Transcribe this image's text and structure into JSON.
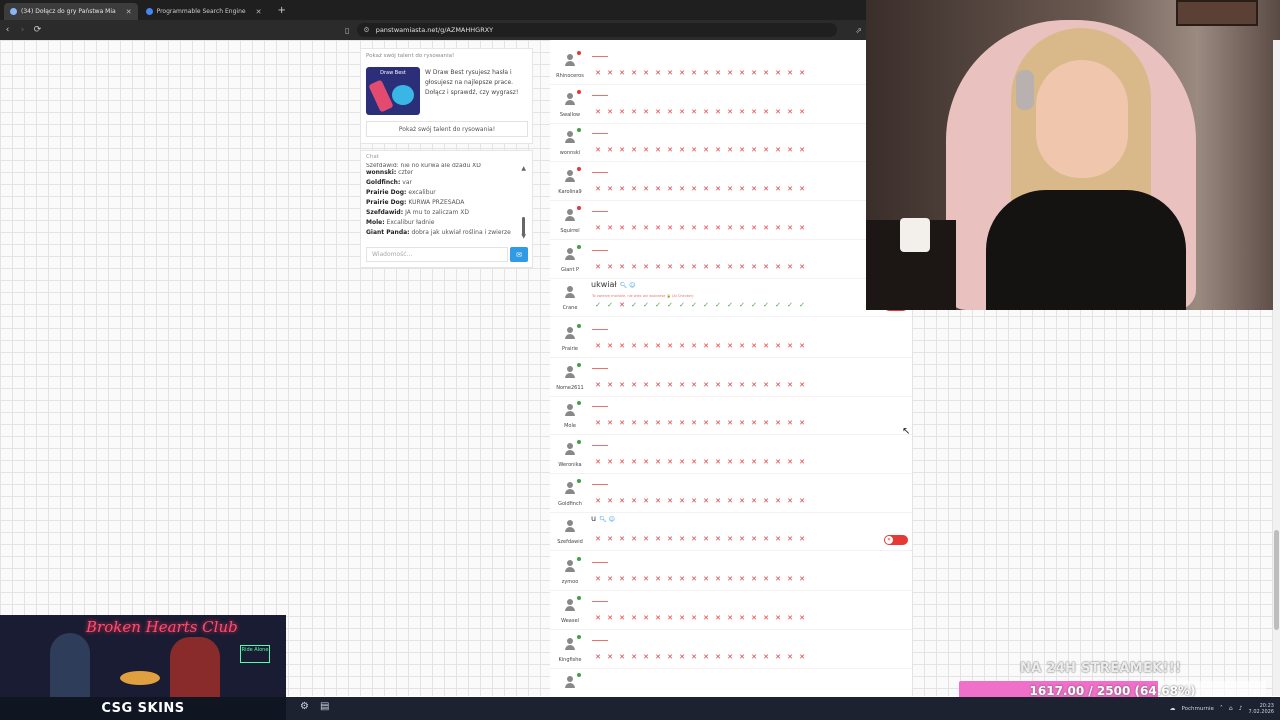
{
  "browser": {
    "tabs": [
      {
        "label": "(34) Dołącz do gry Państwa Mia",
        "active": true
      },
      {
        "label": "Programmable Search Engine",
        "active": false
      }
    ],
    "url": "panstwamiasta.net/g/AZMAHHGRXY"
  },
  "ad": {
    "heading": "Pokaż swój talent do rysowania!",
    "image_title": "Draw Best",
    "text": "W Draw Best rysujesz hasła i głosujesz na najlepsze prace. Dołącz i sprawdź, czy wygrasz!",
    "button": "Pokaż swój talent do rysowania!"
  },
  "chat": {
    "heading": "Chat",
    "partial_line": "Szefdawid: nie no kurwa ale dzadu XD",
    "messages": [
      {
        "user": "wonnski:",
        "text": "czter"
      },
      {
        "user": "Goldfinch:",
        "text": "var"
      },
      {
        "user": "Prairie Dog:",
        "text": "excalibur"
      },
      {
        "user": "Prairie Dog:",
        "text": "KURWA PRZESADA"
      },
      {
        "user": "Szefdawid:",
        "text": "JA mu to zaliczam XD"
      },
      {
        "user": "Mole:",
        "text": "Excalibur ładnie"
      },
      {
        "user": "Giant Panda:",
        "text": "dobra jak ukwiał roślina i zwierze"
      }
    ],
    "placeholder": "Wiadomość..."
  },
  "players": [
    {
      "name": "Rhinoceros",
      "status": "red",
      "answer": "",
      "marks": "xxxxxxxxxxxxxxxxxx"
    },
    {
      "name": "Swallow",
      "status": "red",
      "answer": "",
      "marks": "xxxxxxxxxxxxxxxxxx"
    },
    {
      "name": "wonnski",
      "status": "green",
      "answer": "",
      "marks": "xxxxxxxxxxxxxxxxxx"
    },
    {
      "name": "Karolina9",
      "status": "red",
      "answer": "",
      "marks": "xxxxxxxxxxxxxxxxxx"
    },
    {
      "name": "Squirrel",
      "status": "red",
      "answer": "",
      "marks": "xxxxxxxxxxxxxxxxxx"
    },
    {
      "name": "Giant P",
      "status": "green",
      "answer": "",
      "marks": "xxxxxxxxxxxxxxxxxx"
    },
    {
      "name": "Crane",
      "status": "none",
      "answer": "ukwiał",
      "hint": "To zwierzę morskie, nie więc ani wskrzesę 🔒 (AI Checker)",
      "marks": "vvxvvvvvvvvvvvvvvv",
      "toggle": true
    },
    {
      "name": "Prairie",
      "status": "green",
      "answer": "",
      "marks": "xxxxxxxxxxxxxxxxxx"
    },
    {
      "name": "Nome2611",
      "status": "green",
      "answer": "",
      "marks": "xxxxxxxxxxxxxxxxxx"
    },
    {
      "name": "Mole",
      "status": "green",
      "answer": "",
      "marks": "xxxxxxxxxxxxxxxxxx"
    },
    {
      "name": "Weronika",
      "status": "green",
      "answer": "",
      "marks": "xxxxxxxxxxxxxxxxxx"
    },
    {
      "name": "Goldfinch",
      "status": "green",
      "answer": "",
      "marks": "xxxxxxxxxxxxxxxxxx"
    },
    {
      "name": "Szefdawid",
      "status": "none",
      "answer": "u",
      "marks": "xxxxxxxxxxxxxxxxxx",
      "toggle": true
    },
    {
      "name": "zymoo",
      "status": "green",
      "answer": "",
      "marks": "xxxxxxxxxxxxxxxxxx"
    },
    {
      "name": "Weasel",
      "status": "green",
      "answer": "",
      "marks": "xxxxxxxxxxxxxxxxxx"
    },
    {
      "name": "Kingfishe",
      "status": "green",
      "answer": "",
      "marks": "xxxxxxxxxxxxxxxxxx"
    },
    {
      "name": "",
      "status": "green",
      "answer": "",
      "marks": ""
    }
  ],
  "overlay": {
    "neon_title": "Broken Hearts Club",
    "sign": "Ride Alone",
    "sponsor": "CSG SKINS",
    "goal_label": "NA 24H STREAMEK!!!",
    "goal_text": "1617.00 / 2500 (64.68%)",
    "goal_fraction": 0.6468
  },
  "taskbar": {
    "weather": "Pochmurnie",
    "time": "20:23",
    "date": "7.02.2026"
  },
  "colors": {
    "wrong": "#e53935",
    "correct": "#43a047",
    "send": "#2f9ae6",
    "goal_fill": "#f06fc9"
  }
}
